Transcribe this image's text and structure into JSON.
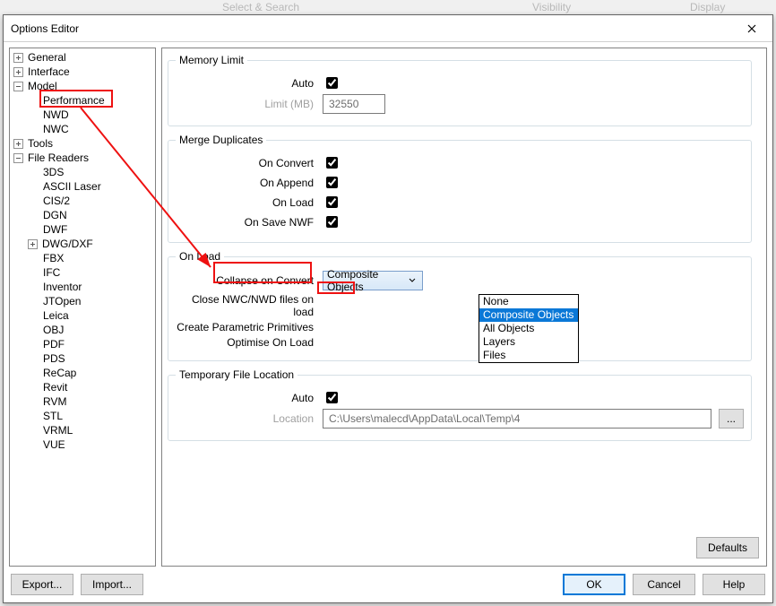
{
  "window": {
    "title": "Options Editor"
  },
  "bg": {
    "a": "Select & Search",
    "b": "Visibility",
    "c": "Display"
  },
  "tree": {
    "general": "General",
    "interface": "Interface",
    "model": "Model",
    "performance": "Performance",
    "nwd": "NWD",
    "nwc": "NWC",
    "tools": "Tools",
    "filereaders": "File Readers",
    "r3ds": "3DS",
    "asciilaser": "ASCII Laser",
    "cis2": "CIS/2",
    "dgn": "DGN",
    "dwf": "DWF",
    "dwgdxf": "DWG/DXF",
    "fbx": "FBX",
    "ifc": "IFC",
    "inventor": "Inventor",
    "jtopen": "JTOpen",
    "leica": "Leica",
    "obj": "OBJ",
    "pdf": "PDF",
    "pds": "PDS",
    "recap": "ReCap",
    "revit": "Revit",
    "rvm": "RVM",
    "stl": "STL",
    "vrml": "VRML",
    "vue": "VUE"
  },
  "memory": {
    "legend": "Memory Limit",
    "auto_label": "Auto",
    "limit_label": "Limit (MB)",
    "limit_value": "32550"
  },
  "merge": {
    "legend": "Merge Duplicates",
    "on_convert": "On Convert",
    "on_append": "On Append",
    "on_load": "On Load",
    "on_save": "On Save NWF"
  },
  "onload": {
    "legend": "On Load",
    "collapse": "Collapse on Convert",
    "close": "Close NWC/NWD files on load",
    "parametric": "Create Parametric Primitives",
    "optimise": "Optimise On Load",
    "combo_value": "Composite Objects",
    "options": {
      "none": "None",
      "composite": "Composite Objects",
      "all": "All Objects",
      "layers": "Layers",
      "files": "Files"
    }
  },
  "temp": {
    "legend": "Temporary File Location",
    "auto_label": "Auto",
    "loc_label": "Location",
    "loc_value": "C:\\Users\\malecd\\AppData\\Local\\Temp\\4",
    "browse": "..."
  },
  "buttons": {
    "defaults": "Defaults",
    "export": "Export...",
    "import": "Import...",
    "ok": "OK",
    "cancel": "Cancel",
    "help": "Help"
  }
}
